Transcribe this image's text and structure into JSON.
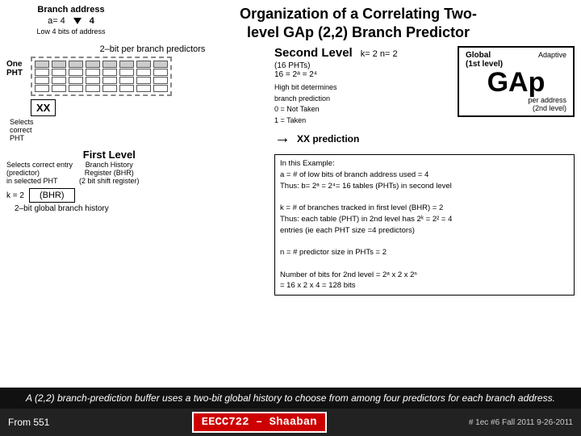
{
  "header": {
    "branch_address_label": "Branch address",
    "a_eq": "a= 4",
    "arrow_val": "4",
    "low4_label": "Low 4 bits of address",
    "title_line1": "Organization of a Correlating Two-",
    "title_line2": "level GAp (2,2) Branch Predictor"
  },
  "main": {
    "predictor_header": "2–bit per branch predictors",
    "one_pht": "One\nPHT",
    "second_level": "Second Level",
    "kn_row": "k= 2    n= 2",
    "phts_count": "(16 PHTs)",
    "phts_formula": "16 = 2ᵃ = 2⁴",
    "high_bit": "High bit determines\nbranch prediction\n0 = Not Taken\n1 = Taken",
    "xx_label": "XX",
    "xx_prediction": "XX prediction",
    "selects_correct": "Selects\ncorrect\nPHT",
    "selects_entry": "Selects correct entry\n(predictor)\nin selected PHT",
    "first_level_title": "First Level",
    "bhr_label": "Branch History\nRegister (BHR)\n(2 bit shift register)",
    "bhr_abbr": "(BHR)",
    "k2_label": "k = 2",
    "global_history": "2–bit global branch history",
    "global_box": {
      "title": "Global\n(1st level)",
      "adaptive": "Adaptive",
      "gap_text": "GAp",
      "per_address": "per address\n(2nd level)"
    },
    "example": {
      "line1": "In this Example:",
      "line2": "a = # of low bits of branch address used  = 4",
      "line3": "Thus:  b= 2ᵃ = 2⁴= 16   tables (PHTs) in second level",
      "line4": "k = # of branches tracked  in first level (BHR) = 2",
      "line5": "Thus: each table (PHT) in 2nd level  has  2ᵏ = 2² = 4",
      "line6": "entries (ie each PHT size =4 predictors)",
      "line7": "n = # predictor size in PHTs = 2",
      "line8": "Number of bits for 2nd level = 2ᵃ x 2 x 2ⁿ",
      "line9": "= 16 x  2 x  4 = 128 bits"
    }
  },
  "bottom_banner": "A (2,2) branch-prediction buffer uses a two-bit global history to choose from among four predictors for each branch address.",
  "footer": {
    "from_label": "From 551",
    "badge": "EECC722 – Shaaban",
    "right_label": "#   1ec #6   Fall 2011   9-26-2011"
  }
}
